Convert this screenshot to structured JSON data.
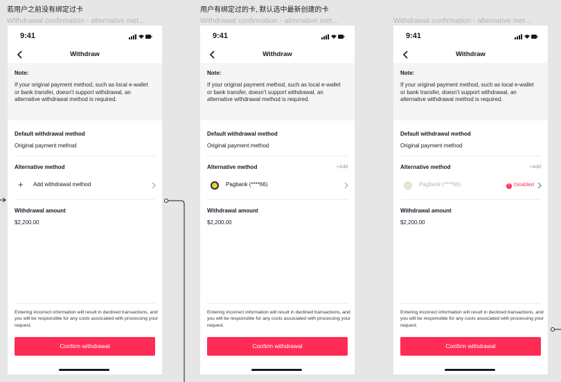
{
  "frames": [
    {
      "caption": "若用户之前没有绑定过卡",
      "subtitle": "Withdrawal confirmation - alternative met..."
    },
    {
      "caption": "用户有绑定过的卡, 默认选中最新创建的卡",
      "subtitle": "Withdrawal confirmation - alternative met..."
    },
    {
      "caption": "",
      "subtitle": "Withdrawal confirmation - alternative met..."
    }
  ],
  "status": {
    "time": "9:41"
  },
  "nav": {
    "title": "Withdraw"
  },
  "note": {
    "title": "Note:",
    "body": "If your original payment method, such as local e-wallet or bank transfer, doesn't support withdrawal, an alternative withdrawal method is required."
  },
  "default_method": {
    "label": "Default withdrawal method",
    "value": "Original payment method"
  },
  "alt_method": {
    "label": "Alternative method",
    "add_link": "+Add",
    "add_row": "Add withdrawal method",
    "bank_row": "Pagbank (****66)",
    "disabled": "Disabled"
  },
  "amount": {
    "label": "Withdrawal amount",
    "value": "$2,200.00"
  },
  "disclaimer": "Entering incorrect information will result in declined transactions, and you will be responsible for any costs associated with processing your request.",
  "confirm_label": "Confirm withdrawal"
}
